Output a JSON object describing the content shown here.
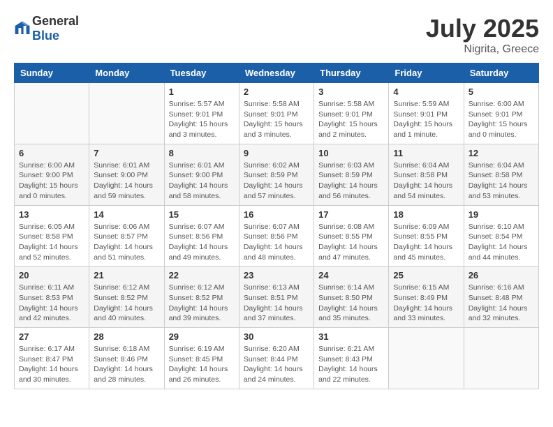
{
  "header": {
    "logo_general": "General",
    "logo_blue": "Blue",
    "month": "July 2025",
    "location": "Nigrita, Greece"
  },
  "weekdays": [
    "Sunday",
    "Monday",
    "Tuesday",
    "Wednesday",
    "Thursday",
    "Friday",
    "Saturday"
  ],
  "weeks": [
    [
      {
        "day": "",
        "info": ""
      },
      {
        "day": "",
        "info": ""
      },
      {
        "day": "1",
        "info": "Sunrise: 5:57 AM\nSunset: 9:01 PM\nDaylight: 15 hours\nand 3 minutes."
      },
      {
        "day": "2",
        "info": "Sunrise: 5:58 AM\nSunset: 9:01 PM\nDaylight: 15 hours\nand 3 minutes."
      },
      {
        "day": "3",
        "info": "Sunrise: 5:58 AM\nSunset: 9:01 PM\nDaylight: 15 hours\nand 2 minutes."
      },
      {
        "day": "4",
        "info": "Sunrise: 5:59 AM\nSunset: 9:01 PM\nDaylight: 15 hours\nand 1 minute."
      },
      {
        "day": "5",
        "info": "Sunrise: 6:00 AM\nSunset: 9:01 PM\nDaylight: 15 hours\nand 0 minutes."
      }
    ],
    [
      {
        "day": "6",
        "info": "Sunrise: 6:00 AM\nSunset: 9:00 PM\nDaylight: 15 hours\nand 0 minutes."
      },
      {
        "day": "7",
        "info": "Sunrise: 6:01 AM\nSunset: 9:00 PM\nDaylight: 14 hours\nand 59 minutes."
      },
      {
        "day": "8",
        "info": "Sunrise: 6:01 AM\nSunset: 9:00 PM\nDaylight: 14 hours\nand 58 minutes."
      },
      {
        "day": "9",
        "info": "Sunrise: 6:02 AM\nSunset: 8:59 PM\nDaylight: 14 hours\nand 57 minutes."
      },
      {
        "day": "10",
        "info": "Sunrise: 6:03 AM\nSunset: 8:59 PM\nDaylight: 14 hours\nand 56 minutes."
      },
      {
        "day": "11",
        "info": "Sunrise: 6:04 AM\nSunset: 8:58 PM\nDaylight: 14 hours\nand 54 minutes."
      },
      {
        "day": "12",
        "info": "Sunrise: 6:04 AM\nSunset: 8:58 PM\nDaylight: 14 hours\nand 53 minutes."
      }
    ],
    [
      {
        "day": "13",
        "info": "Sunrise: 6:05 AM\nSunset: 8:58 PM\nDaylight: 14 hours\nand 52 minutes."
      },
      {
        "day": "14",
        "info": "Sunrise: 6:06 AM\nSunset: 8:57 PM\nDaylight: 14 hours\nand 51 minutes."
      },
      {
        "day": "15",
        "info": "Sunrise: 6:07 AM\nSunset: 8:56 PM\nDaylight: 14 hours\nand 49 minutes."
      },
      {
        "day": "16",
        "info": "Sunrise: 6:07 AM\nSunset: 8:56 PM\nDaylight: 14 hours\nand 48 minutes."
      },
      {
        "day": "17",
        "info": "Sunrise: 6:08 AM\nSunset: 8:55 PM\nDaylight: 14 hours\nand 47 minutes."
      },
      {
        "day": "18",
        "info": "Sunrise: 6:09 AM\nSunset: 8:55 PM\nDaylight: 14 hours\nand 45 minutes."
      },
      {
        "day": "19",
        "info": "Sunrise: 6:10 AM\nSunset: 8:54 PM\nDaylight: 14 hours\nand 44 minutes."
      }
    ],
    [
      {
        "day": "20",
        "info": "Sunrise: 6:11 AM\nSunset: 8:53 PM\nDaylight: 14 hours\nand 42 minutes."
      },
      {
        "day": "21",
        "info": "Sunrise: 6:12 AM\nSunset: 8:52 PM\nDaylight: 14 hours\nand 40 minutes."
      },
      {
        "day": "22",
        "info": "Sunrise: 6:12 AM\nSunset: 8:52 PM\nDaylight: 14 hours\nand 39 minutes."
      },
      {
        "day": "23",
        "info": "Sunrise: 6:13 AM\nSunset: 8:51 PM\nDaylight: 14 hours\nand 37 minutes."
      },
      {
        "day": "24",
        "info": "Sunrise: 6:14 AM\nSunset: 8:50 PM\nDaylight: 14 hours\nand 35 minutes."
      },
      {
        "day": "25",
        "info": "Sunrise: 6:15 AM\nSunset: 8:49 PM\nDaylight: 14 hours\nand 33 minutes."
      },
      {
        "day": "26",
        "info": "Sunrise: 6:16 AM\nSunset: 8:48 PM\nDaylight: 14 hours\nand 32 minutes."
      }
    ],
    [
      {
        "day": "27",
        "info": "Sunrise: 6:17 AM\nSunset: 8:47 PM\nDaylight: 14 hours\nand 30 minutes."
      },
      {
        "day": "28",
        "info": "Sunrise: 6:18 AM\nSunset: 8:46 PM\nDaylight: 14 hours\nand 28 minutes."
      },
      {
        "day": "29",
        "info": "Sunrise: 6:19 AM\nSunset: 8:45 PM\nDaylight: 14 hours\nand 26 minutes."
      },
      {
        "day": "30",
        "info": "Sunrise: 6:20 AM\nSunset: 8:44 PM\nDaylight: 14 hours\nand 24 minutes."
      },
      {
        "day": "31",
        "info": "Sunrise: 6:21 AM\nSunset: 8:43 PM\nDaylight: 14 hours\nand 22 minutes."
      },
      {
        "day": "",
        "info": ""
      },
      {
        "day": "",
        "info": ""
      }
    ]
  ]
}
